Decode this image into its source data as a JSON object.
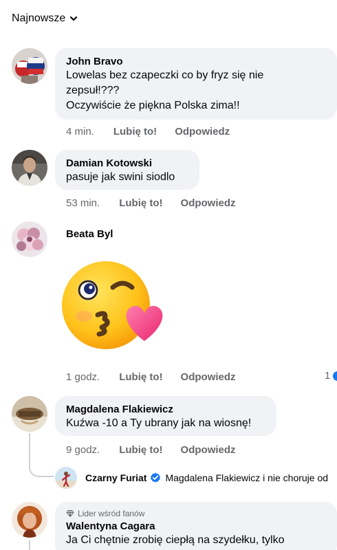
{
  "sort": {
    "label": "Najnowsze",
    "icon": "chevron-down-icon"
  },
  "comments": [
    {
      "author": "John Bravo",
      "text": "Lowelas bez czapeczki co by fryz się nie\nzepsuł!???\nOczywiście że piękna Polska zima!!",
      "time": "4 min.",
      "like": "Lubię to!",
      "reply": "Odpowiedz"
    },
    {
      "author": "Damian Kotowski",
      "text": "pasuje jak swini siodlo",
      "time": "53 min.",
      "like": "Lubię to!",
      "reply": "Odpowiedz"
    },
    {
      "author": "Beata Byl",
      "sticker": "blowing-kiss-emoji",
      "time": "1 godz.",
      "like": "Lubię to!",
      "reply": "Odpowiedz",
      "reaction_count": "1"
    },
    {
      "author": "Magdalena Flakiewicz",
      "text": "Kuźwa -10 a Ty ubrany jak na wiosnę!",
      "time": "9 godz.",
      "like": "Lubię to!",
      "reply": "Odpowiedz",
      "reply_preview": {
        "author": "Czarny Furiat",
        "verified_icon": "verified-badge-icon",
        "snippet": "Magdalena Flakiewicz i nie choruje od"
      }
    },
    {
      "badge": "Lider wśród fanów",
      "badge_icon": "diamond-icon",
      "author": "Walentyna Cagara",
      "text": "Ja Ci chętnie zrobię ciepłą na szydełku, tylko"
    }
  ],
  "colors": {
    "bubble": "#f0f2f5",
    "meta": "#65676b",
    "accent": "#1877f2"
  }
}
